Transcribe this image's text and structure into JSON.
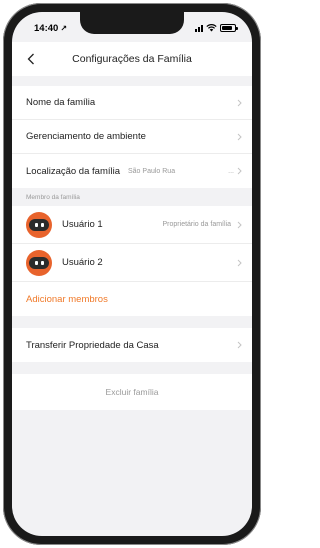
{
  "status_bar": {
    "time": "14:40",
    "location_arrow": "↗"
  },
  "nav": {
    "title": "Configurações da Família",
    "back_icon": "chevron-left-icon"
  },
  "settings": [
    {
      "label": "Nome da família",
      "value": ""
    },
    {
      "label": "Gerenciamento de ambiente",
      "value": ""
    },
    {
      "label": "Localização da família",
      "value": "São Paulo Rua",
      "trailing": "..."
    }
  ],
  "members_section": {
    "header": "Membro da família",
    "members": [
      {
        "name": "Usuário 1",
        "role": "Proprietário da família"
      },
      {
        "name": "Usuário 2",
        "role": ""
      }
    ],
    "add_label": "Adicionar membros"
  },
  "transfer_label": "Transferir Propriedade da Casa",
  "delete_label": "Excluir família",
  "colors": {
    "accent": "#f07a2a",
    "avatar_bg": "#e8632c",
    "background": "#f2f2f4"
  }
}
